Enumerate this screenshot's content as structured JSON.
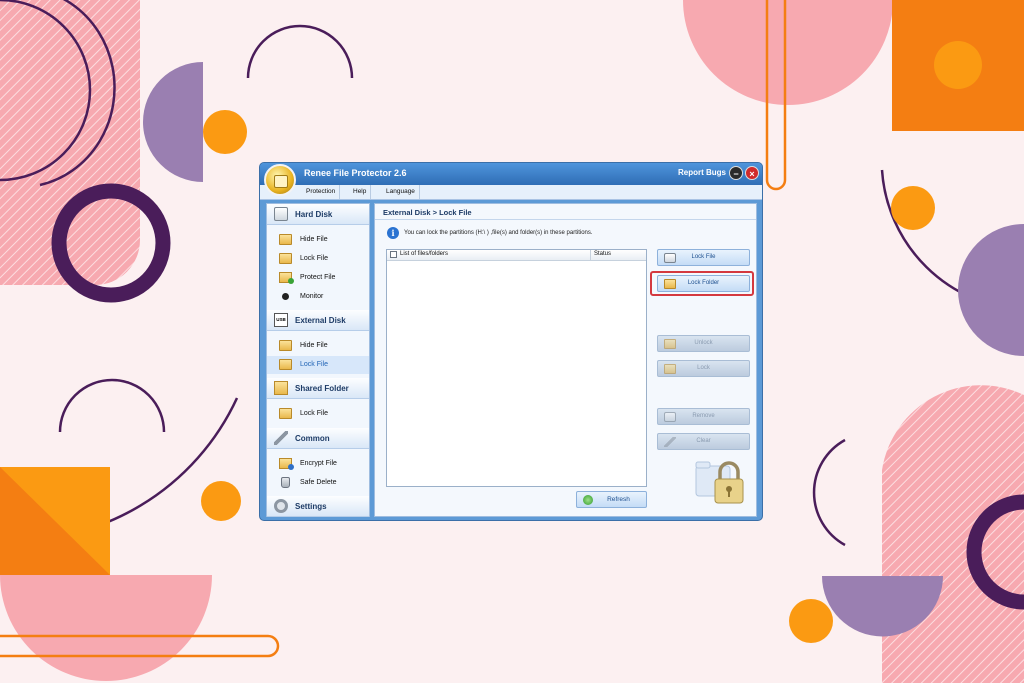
{
  "window": {
    "title": "Renee File Protector 2.6",
    "report_bugs": "Report Bugs",
    "minimize_glyph": "−",
    "close_glyph": "×"
  },
  "menu": {
    "items": [
      "Protection",
      "Help",
      "Language"
    ]
  },
  "sidebar": {
    "sections": [
      {
        "title": "Hard Disk",
        "icon": "hard-disk-icon",
        "items": [
          {
            "label": "Hide File",
            "icon": "folder-icon"
          },
          {
            "label": "Lock File",
            "icon": "folder-lock-icon"
          },
          {
            "label": "Protect File",
            "icon": "protect-file-icon"
          },
          {
            "label": "Monitor",
            "icon": "monitor-icon"
          }
        ]
      },
      {
        "title": "External Disk",
        "icon": "usb-icon",
        "usb_text": "USB",
        "items": [
          {
            "label": "Hide File",
            "icon": "folder-icon"
          },
          {
            "label": "Lock File",
            "icon": "folder-lock-icon",
            "active": true
          }
        ]
      },
      {
        "title": "Shared Folder",
        "icon": "shared-folder-icon",
        "items": [
          {
            "label": "Lock File",
            "icon": "folder-lock-icon"
          }
        ]
      },
      {
        "title": "Common",
        "icon": "tools-icon",
        "items": [
          {
            "label": "Encrypt File",
            "icon": "encrypt-file-icon"
          },
          {
            "label": "Safe Delete",
            "icon": "trash-icon"
          }
        ]
      },
      {
        "title": "Settings",
        "icon": "gear-icon",
        "items": []
      }
    ]
  },
  "main": {
    "breadcrumb": "External Disk > Lock File",
    "info_text": "You can lock the partitions  (H:\\ ) ,file(s) and folder(s) in these partitions.",
    "info_glyph": "i",
    "list_headers": {
      "name": "List of files/folders",
      "status": "Status"
    },
    "buttons": {
      "lock_file": "Lock File",
      "lock_folder": "Lock Folder",
      "unlock": "Unlock",
      "lock": "Lock",
      "remove": "Remove",
      "clear": "Clear",
      "refresh": "Refresh"
    }
  },
  "colors": {
    "accent": "#2f6db5",
    "highlight": "#d4393f",
    "background": "#fcf0f1"
  }
}
